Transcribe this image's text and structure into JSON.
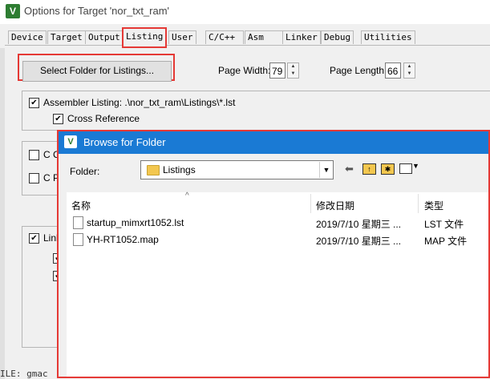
{
  "window": {
    "title": "Options for Target 'nor_txt_ram'",
    "app_icon": "keil-uvision-icon"
  },
  "tabs": [
    {
      "label": "Device"
    },
    {
      "label": "Target"
    },
    {
      "label": "Output"
    },
    {
      "label": "Listing",
      "active": true
    },
    {
      "label": "User"
    },
    {
      "label": "C/C++"
    },
    {
      "label": "Asm"
    },
    {
      "label": "Linker"
    },
    {
      "label": "Debug"
    },
    {
      "label": "Utilities"
    }
  ],
  "listing": {
    "select_folder_label": "Select Folder for Listings...",
    "page_width_label": "Page Width:",
    "page_width_value": "79",
    "page_length_label": "Page Length:",
    "page_length_value": "66",
    "assembler_listing_label": "Assembler Listing:  .\\nor_txt_ram\\Listings\\*.lst",
    "cross_reference_label": "Cross Reference",
    "c_compiler_label_partial": "C C",
    "c_preprocessor_label_partial": "C P",
    "linker_label_partial": "Link",
    "bottom_text_partial": "ILE: gmac"
  },
  "browse_dialog": {
    "title": "Browse for Folder",
    "folder_label": "Folder:",
    "folder_value": "Listings",
    "toolbar_icons": [
      "back-arrow-icon",
      "up-folder-icon",
      "new-folder-icon",
      "view-menu-icon"
    ],
    "columns": [
      "名称",
      "修改日期",
      "类型"
    ],
    "files": [
      {
        "name": "startup_mimxrt1052.lst",
        "date": "2019/7/10 星期三 ...",
        "type": "LST 文件"
      },
      {
        "name": "YH-RT1052.map",
        "date": "2019/7/10 星期三 ...",
        "type": "MAP 文件"
      }
    ]
  }
}
